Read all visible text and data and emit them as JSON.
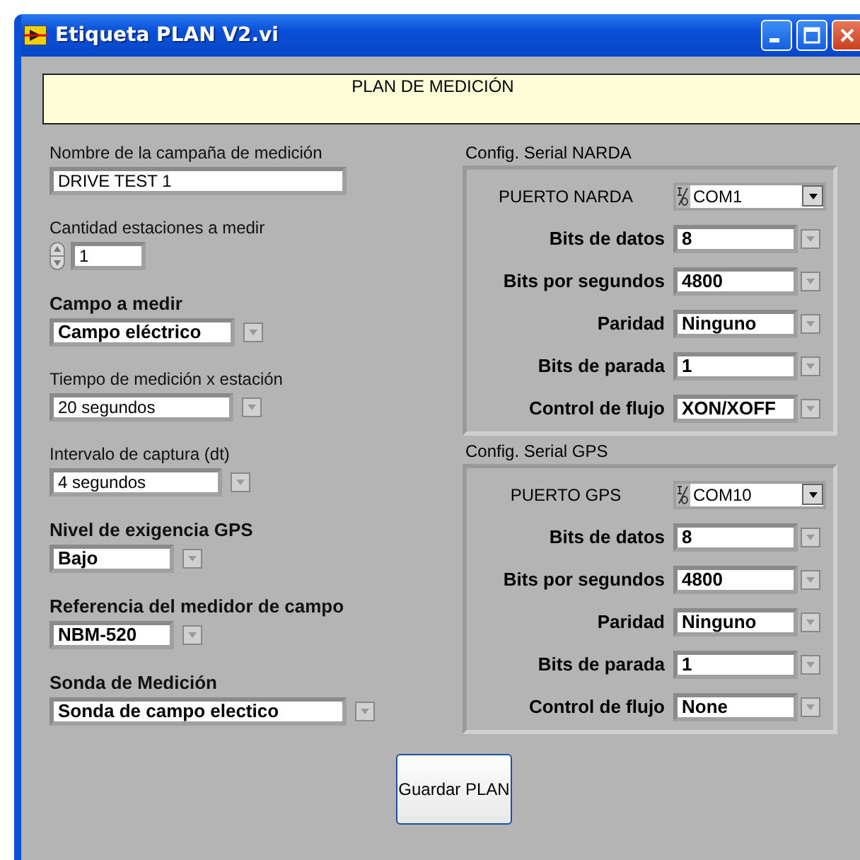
{
  "window": {
    "title": "Etiqueta PLAN V2.vi"
  },
  "banner": "PLAN DE MEDICIÓN",
  "fields": [
    {
      "label": "Nombre de la campaña de medición",
      "bold": false,
      "kind": "text",
      "value": "DRIVE TEST 1"
    },
    {
      "label": "Cantidad estaciones a medir",
      "bold": false,
      "kind": "numeric",
      "value": "1"
    },
    {
      "label": "Campo a medir",
      "bold": true,
      "kind": "ring",
      "value": "Campo eléctrico"
    },
    {
      "label": "Tiempo de medición x estación",
      "bold": false,
      "kind": "ring",
      "value": "20 segundos"
    },
    {
      "label": "Intervalo de captura (dt)",
      "bold": false,
      "kind": "ring",
      "value": "4 segundos"
    },
    {
      "label": "Nivel de exigencia GPS",
      "bold": true,
      "kind": "ring",
      "value": "Bajo"
    },
    {
      "label": "Referencia del medidor de campo",
      "bold": true,
      "kind": "ring",
      "value": "NBM-520"
    },
    {
      "label": "Sonda de Medición",
      "bold": true,
      "kind": "ring",
      "value": "Sonda de campo electico"
    }
  ],
  "serial_configs": [
    {
      "title": "Config. Serial NARDA",
      "rows": [
        {
          "label": "PUERTO NARDA",
          "bold": false,
          "kind": "resource",
          "value": "COM1"
        },
        {
          "label": "Bits de datos",
          "bold": true,
          "kind": "ring",
          "value": "8"
        },
        {
          "label": "Bits por segundos",
          "bold": true,
          "kind": "ring",
          "value": "4800"
        },
        {
          "label": "Paridad",
          "bold": true,
          "kind": "ring",
          "value": "Ninguno"
        },
        {
          "label": "Bits de parada",
          "bold": true,
          "kind": "ring",
          "value": "1"
        },
        {
          "label": "Control de flujo",
          "bold": true,
          "kind": "ring",
          "value": "XON/XOFF"
        }
      ]
    },
    {
      "title": "Config. Serial GPS",
      "rows": [
        {
          "label": "PUERTO GPS",
          "bold": false,
          "kind": "resource",
          "value": "COM10"
        },
        {
          "label": "Bits de datos",
          "bold": true,
          "kind": "ring",
          "value": "8"
        },
        {
          "label": "Bits por segundos",
          "bold": true,
          "kind": "ring",
          "value": "4800"
        },
        {
          "label": "Paridad",
          "bold": true,
          "kind": "ring",
          "value": "Ninguno"
        },
        {
          "label": "Bits de parada",
          "bold": true,
          "kind": "ring",
          "value": "1"
        },
        {
          "label": "Control de flujo",
          "bold": true,
          "kind": "ring",
          "value": "None"
        }
      ]
    }
  ],
  "save_button": "Guardar PLAN"
}
